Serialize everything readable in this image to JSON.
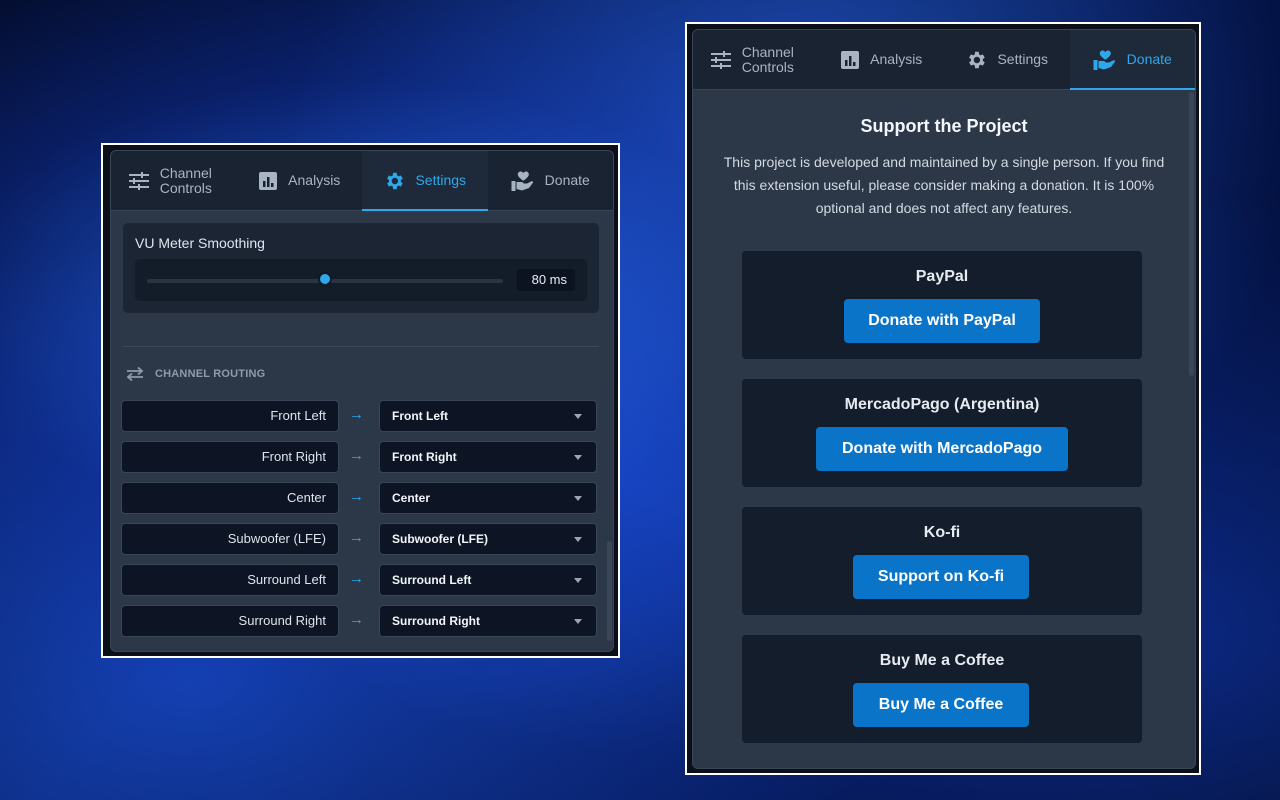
{
  "tabs_labels": {
    "channel_controls": "Channel Controls",
    "analysis": "Analysis",
    "settings": "Settings",
    "donate": "Donate"
  },
  "colors": {
    "accent": "#2ea8ea",
    "donate_button": "#0a74c9",
    "panel_bg": "#2c3747"
  },
  "left_panel": {
    "active_tab": "Settings",
    "vu_meter": {
      "label": "VU Meter Smoothing",
      "value": "80 ms",
      "slider_fraction": 0.5
    },
    "routing": {
      "title": "CHANNEL ROUTING",
      "arrow": "→",
      "rows": [
        {
          "source": "Front Left",
          "target": "Front Left"
        },
        {
          "source": "Front Right",
          "target": "Front Right"
        },
        {
          "source": "Center",
          "target": "Center"
        },
        {
          "source": "Subwoofer (LFE)",
          "target": "Subwoofer (LFE)"
        },
        {
          "source": "Surround Left",
          "target": "Surround Left"
        },
        {
          "source": "Surround Right",
          "target": "Surround Right"
        }
      ]
    }
  },
  "right_panel": {
    "active_tab": "Donate",
    "title": "Support the Project",
    "description": "This project is developed and maintained by a single person. If you find this extension useful, please consider making a donation. It is 100% optional and does not affect any features.",
    "options": [
      {
        "name": "PayPal",
        "button": "Donate with PayPal"
      },
      {
        "name": "MercadoPago (Argentina)",
        "button": "Donate with MercadoPago"
      },
      {
        "name": "Ko-fi",
        "button": "Support on Ko-fi"
      },
      {
        "name": "Buy Me a Coffee",
        "button": "Buy Me a Coffee"
      }
    ]
  }
}
